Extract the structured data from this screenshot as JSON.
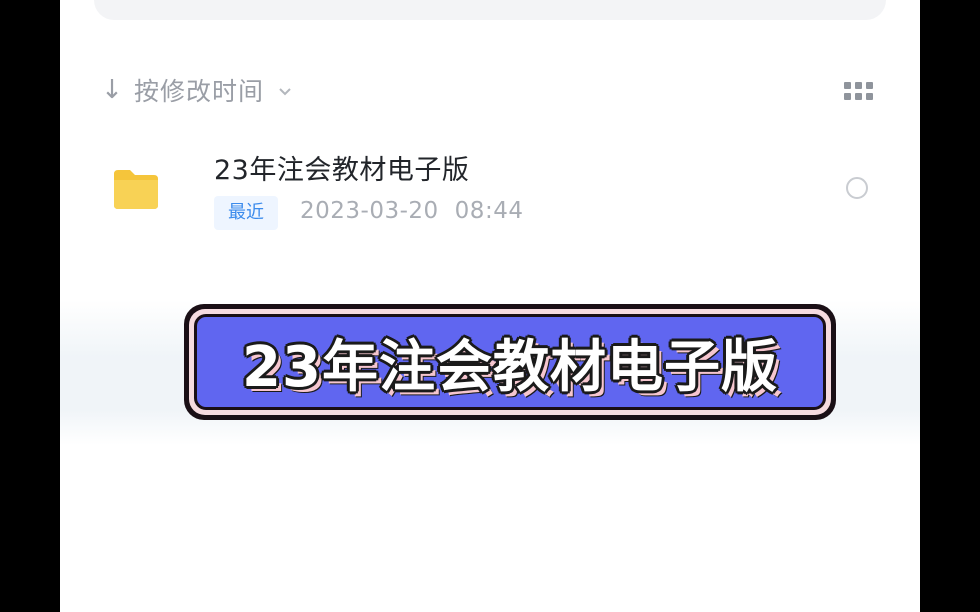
{
  "sort": {
    "label": "按修改时间",
    "arrow": "↓"
  },
  "files": [
    {
      "name": "23年注会教材电子版",
      "badge": "最近",
      "date": "2023-03-20",
      "time": "08:44"
    }
  ],
  "banner": {
    "text": "23年注会教材电子版"
  },
  "colors": {
    "folder": "#f7cc44",
    "badge_text": "#3b8bec",
    "banner_bg": "#6066f0"
  }
}
